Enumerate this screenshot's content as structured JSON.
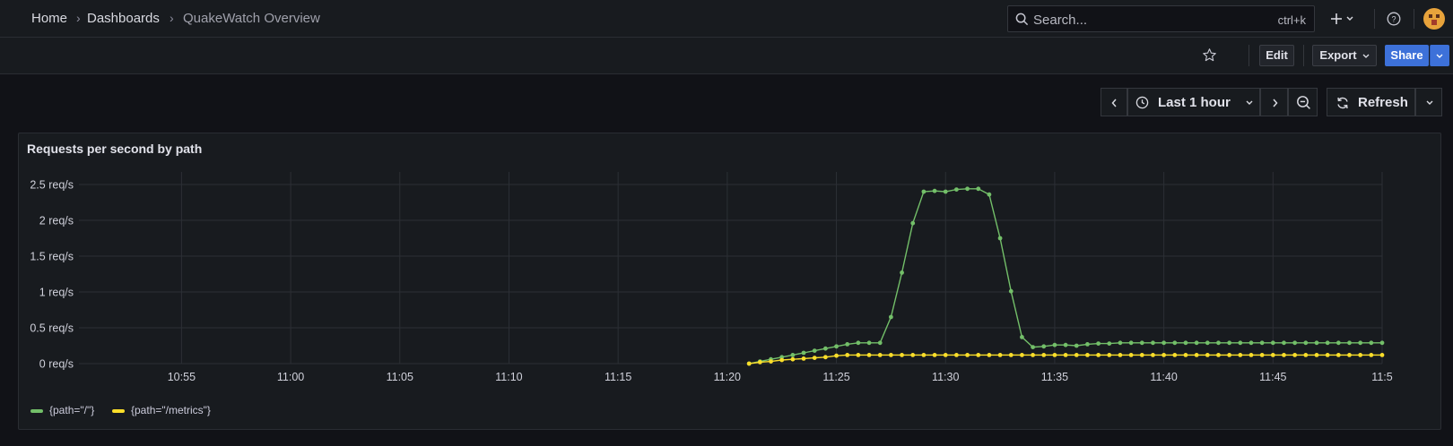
{
  "breadcrumb": {
    "home": "Home",
    "dashboards": "Dashboards",
    "current": "QuakeWatch Overview"
  },
  "search": {
    "placeholder": "Search...",
    "shortcut": "ctrl+k"
  },
  "toolbar": {
    "edit": "Edit",
    "export": "Export",
    "share": "Share"
  },
  "time_range": {
    "label": "Last 1 hour",
    "refresh": "Refresh"
  },
  "panel": {
    "title": "Requests per second by path"
  },
  "colors": {
    "series_root": "#73bf69",
    "series_metrics": "#fade2a",
    "accent": "#3d71d9"
  },
  "icons": [
    "search-icon",
    "plus-icon",
    "chevron-down-icon",
    "help-icon",
    "avatar",
    "star-icon",
    "chevron-left-icon",
    "clock-icon",
    "chevron-right-icon",
    "zoom-out-icon",
    "refresh-icon"
  ],
  "chart_data": {
    "type": "line",
    "title": "Requests per second by path",
    "y_tick_labels": [
      "0 req/s",
      "0.5 req/s",
      "1 req/s",
      "1.5 req/s",
      "2 req/s",
      "2.5 req/s"
    ],
    "ylim": [
      0,
      2.5
    ],
    "x_tick_labels": [
      "10:55",
      "11:00",
      "11:05",
      "11:10",
      "11:15",
      "11:20",
      "11:25",
      "11:30",
      "11:35",
      "11:40",
      "11:45",
      "11:5"
    ],
    "x_ticks_min": [
      55,
      60,
      65,
      70,
      75,
      80,
      85,
      90,
      95,
      100,
      105,
      110
    ],
    "xlim_minutes_after_10h": [
      50.3,
      110.0
    ],
    "grid": true,
    "legend_placement": "bottom-left",
    "series": [
      {
        "name": "{path=\"/\"}",
        "color": "#73bf69",
        "x": [
          81.0,
          81.5,
          82.0,
          82.5,
          83.0,
          83.5,
          84.0,
          84.5,
          85.0,
          85.5,
          86.0,
          86.5,
          87.0,
          87.5,
          88.0,
          88.5,
          89.0,
          89.5,
          90.0,
          90.5,
          91.0,
          91.5,
          92.0,
          92.5,
          93.0,
          93.5,
          94.0,
          94.5,
          95.0,
          95.5,
          96.0,
          96.5,
          97.0,
          97.5,
          98.0,
          98.5,
          99.0,
          99.5,
          100.0,
          100.5,
          101.0,
          101.5,
          102.0,
          102.5,
          103.0,
          103.5,
          104.0,
          104.5,
          105.0,
          105.5,
          106.0,
          106.5,
          107.0,
          107.5,
          108.0,
          108.5,
          109.0,
          109.5,
          110.0
        ],
        "y": [
          0.0,
          0.03,
          0.06,
          0.09,
          0.12,
          0.15,
          0.18,
          0.21,
          0.24,
          0.27,
          0.29,
          0.29,
          0.29,
          0.65,
          1.27,
          1.96,
          2.4,
          2.41,
          2.4,
          2.43,
          2.44,
          2.44,
          2.36,
          1.75,
          1.01,
          0.37,
          0.23,
          0.24,
          0.26,
          0.26,
          0.25,
          0.27,
          0.28,
          0.28,
          0.29,
          0.29,
          0.29,
          0.29,
          0.29,
          0.29,
          0.29,
          0.29,
          0.29,
          0.29,
          0.29,
          0.29,
          0.29,
          0.29,
          0.29,
          0.29,
          0.29,
          0.29,
          0.29,
          0.29,
          0.29,
          0.29,
          0.29,
          0.29,
          0.29
        ]
      },
      {
        "name": "{path=\"/metrics\"}",
        "color": "#fade2a",
        "x": [
          81.0,
          81.5,
          82.0,
          82.5,
          83.0,
          83.5,
          84.0,
          84.5,
          85.0,
          85.5,
          86.0,
          86.5,
          87.0,
          87.5,
          88.0,
          88.5,
          89.0,
          89.5,
          90.0,
          90.5,
          91.0,
          91.5,
          92.0,
          92.5,
          93.0,
          93.5,
          94.0,
          94.5,
          95.0,
          95.5,
          96.0,
          96.5,
          97.0,
          97.5,
          98.0,
          98.5,
          99.0,
          99.5,
          100.0,
          100.5,
          101.0,
          101.5,
          102.0,
          102.5,
          103.0,
          103.5,
          104.0,
          104.5,
          105.0,
          105.5,
          106.0,
          106.5,
          107.0,
          107.5,
          108.0,
          108.5,
          109.0,
          109.5,
          110.0
        ],
        "y": [
          0.0,
          0.02,
          0.03,
          0.05,
          0.06,
          0.07,
          0.08,
          0.09,
          0.11,
          0.12,
          0.12,
          0.12,
          0.12,
          0.12,
          0.12,
          0.12,
          0.12,
          0.12,
          0.12,
          0.12,
          0.12,
          0.12,
          0.12,
          0.12,
          0.12,
          0.12,
          0.12,
          0.12,
          0.12,
          0.12,
          0.12,
          0.12,
          0.12,
          0.12,
          0.12,
          0.12,
          0.12,
          0.12,
          0.12,
          0.12,
          0.12,
          0.12,
          0.12,
          0.12,
          0.12,
          0.12,
          0.12,
          0.12,
          0.12,
          0.12,
          0.12,
          0.12,
          0.12,
          0.12,
          0.12,
          0.12,
          0.12,
          0.12,
          0.12
        ]
      }
    ]
  }
}
